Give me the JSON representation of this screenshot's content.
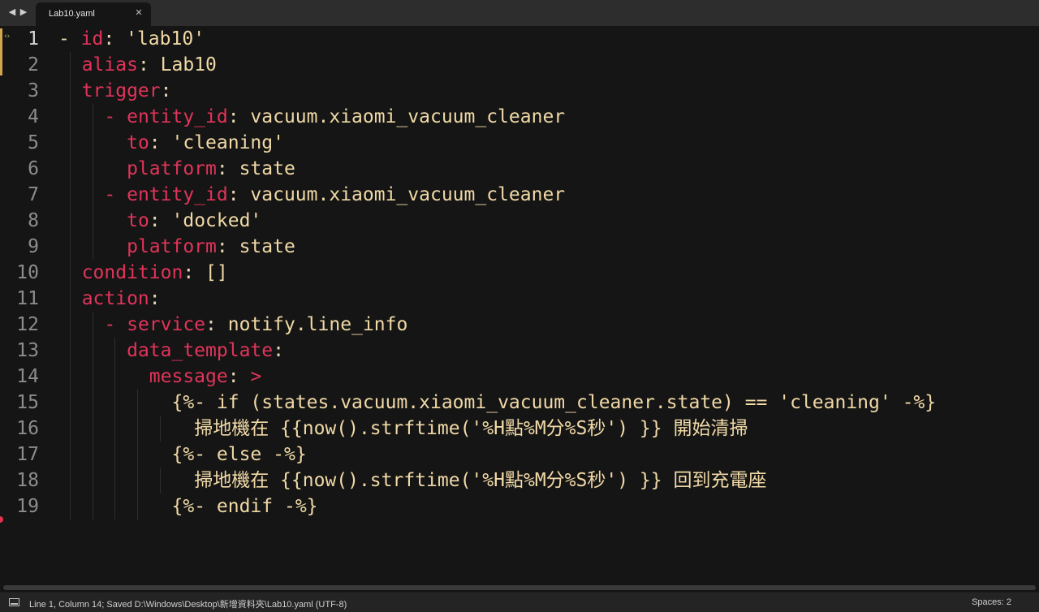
{
  "tab": {
    "title": "Lab10.yaml",
    "close": "✕",
    "back": "◀",
    "forward": "▶"
  },
  "lines": [
    {
      "n": "1",
      "indent": 0,
      "tokens": [
        {
          "t": "- ",
          "c": "p"
        },
        {
          "t": "id",
          "c": "k"
        },
        {
          "t": ": ",
          "c": "p"
        },
        {
          "t": "'lab10'",
          "c": "v"
        }
      ]
    },
    {
      "n": "2",
      "indent": 1,
      "tokens": [
        {
          "t": "alias",
          "c": "k"
        },
        {
          "t": ": ",
          "c": "p"
        },
        {
          "t": "Lab10",
          "c": "v"
        }
      ]
    },
    {
      "n": "3",
      "indent": 1,
      "tokens": [
        {
          "t": "trigger",
          "c": "k"
        },
        {
          "t": ":",
          "c": "p"
        }
      ]
    },
    {
      "n": "4",
      "indent": 2,
      "tokens": [
        {
          "t": "- ",
          "c": "k"
        },
        {
          "t": "entity_id",
          "c": "k"
        },
        {
          "t": ": ",
          "c": "p"
        },
        {
          "t": "vacuum.xiaomi_vacuum_cleaner",
          "c": "v"
        }
      ]
    },
    {
      "n": "5",
      "indent": 3,
      "tokens": [
        {
          "t": "to",
          "c": "k"
        },
        {
          "t": ": ",
          "c": "p"
        },
        {
          "t": "'cleaning'",
          "c": "v"
        }
      ]
    },
    {
      "n": "6",
      "indent": 3,
      "tokens": [
        {
          "t": "platform",
          "c": "k"
        },
        {
          "t": ": ",
          "c": "p"
        },
        {
          "t": "state",
          "c": "v"
        }
      ]
    },
    {
      "n": "7",
      "indent": 2,
      "tokens": [
        {
          "t": "- ",
          "c": "k"
        },
        {
          "t": "entity_id",
          "c": "k"
        },
        {
          "t": ": ",
          "c": "p"
        },
        {
          "t": "vacuum.xiaomi_vacuum_cleaner",
          "c": "v"
        }
      ]
    },
    {
      "n": "8",
      "indent": 3,
      "tokens": [
        {
          "t": "to",
          "c": "k"
        },
        {
          "t": ": ",
          "c": "p"
        },
        {
          "t": "'docked'",
          "c": "v"
        }
      ]
    },
    {
      "n": "9",
      "indent": 3,
      "tokens": [
        {
          "t": "platform",
          "c": "k"
        },
        {
          "t": ": ",
          "c": "p"
        },
        {
          "t": "state",
          "c": "v"
        }
      ]
    },
    {
      "n": "10",
      "indent": 1,
      "tokens": [
        {
          "t": "condition",
          "c": "k"
        },
        {
          "t": ": ",
          "c": "p"
        },
        {
          "t": "[]",
          "c": "v"
        }
      ]
    },
    {
      "n": "11",
      "indent": 1,
      "tokens": [
        {
          "t": "action",
          "c": "k"
        },
        {
          "t": ":",
          "c": "p"
        }
      ]
    },
    {
      "n": "12",
      "indent": 2,
      "tokens": [
        {
          "t": "- ",
          "c": "k"
        },
        {
          "t": "service",
          "c": "k"
        },
        {
          "t": ": ",
          "c": "p"
        },
        {
          "t": "notify.line_info",
          "c": "v"
        }
      ]
    },
    {
      "n": "13",
      "indent": 3,
      "tokens": [
        {
          "t": "data_template",
          "c": "k"
        },
        {
          "t": ":",
          "c": "p"
        }
      ]
    },
    {
      "n": "14",
      "indent": 4,
      "tokens": [
        {
          "t": "message",
          "c": "k"
        },
        {
          "t": ": ",
          "c": "p"
        },
        {
          "t": ">",
          "c": "k"
        }
      ]
    },
    {
      "n": "15",
      "indent": 5,
      "tokens": [
        {
          "t": "{%- if (states.vacuum.xiaomi_vacuum_cleaner.state) == 'cleaning' -%}",
          "c": "v"
        }
      ]
    },
    {
      "n": "16",
      "indent": 6,
      "tokens": [
        {
          "t": "掃地機在 {{now().strftime('%H點%M分%S秒') }} 開始清掃",
          "c": "v"
        }
      ]
    },
    {
      "n": "17",
      "indent": 5,
      "tokens": [
        {
          "t": "{%- else -%}",
          "c": "v"
        }
      ]
    },
    {
      "n": "18",
      "indent": 6,
      "tokens": [
        {
          "t": "掃地機在 {{now().strftime('%H點%M分%S秒') }} 回到充電座",
          "c": "v"
        }
      ]
    },
    {
      "n": "19",
      "indent": 5,
      "tokens": [
        {
          "t": "{%- endif -%}",
          "c": "v"
        }
      ]
    }
  ],
  "status": {
    "left": "Line 1, Column 14; Saved D:\\Windows\\Desktop\\新增資料夾\\Lab10.yaml (UTF-8)",
    "right": "Spaces: 2"
  },
  "colors": {
    "key": "#e0345a",
    "value": "#f0d9a6",
    "punct": "#e8d9b5",
    "background": "#151515"
  }
}
